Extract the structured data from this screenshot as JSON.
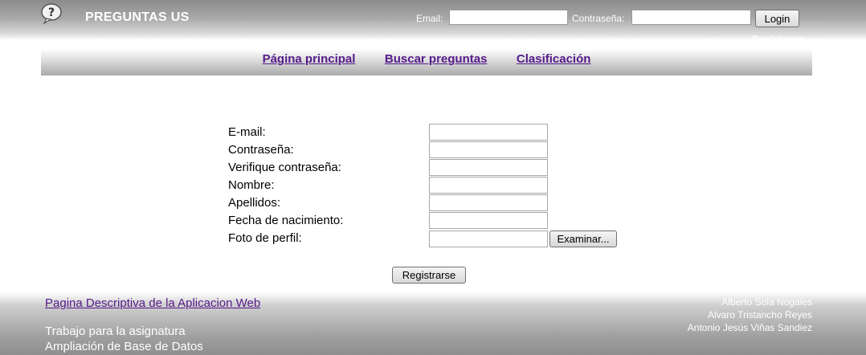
{
  "header": {
    "title": "PREGUNTAS US",
    "logo_icon": "speech-bubble-question-icon",
    "login": {
      "email_label": "Email:",
      "email_value": "",
      "password_label": "Contraseña:",
      "password_value": "",
      "login_button": "Login",
      "register_link": "Registrarse"
    }
  },
  "nav": {
    "items": [
      {
        "label": "Página principal"
      },
      {
        "label": "Buscar preguntas"
      },
      {
        "label": "Clasificación"
      }
    ]
  },
  "form": {
    "fields": [
      {
        "label": "E-mail:",
        "value": ""
      },
      {
        "label": "Contraseña:",
        "value": ""
      },
      {
        "label": "Verifique contraseña:",
        "value": ""
      },
      {
        "label": "Nombre:",
        "value": ""
      },
      {
        "label": "Apellidos:",
        "value": ""
      },
      {
        "label": "Fecha de nacimiento:",
        "value": ""
      },
      {
        "label": "Foto de perfil:",
        "value": ""
      }
    ],
    "browse_button": "Examinar...",
    "submit_button": "Registrarse"
  },
  "footer": {
    "link": "Pagina Descriptiva de la Aplicacion Web",
    "text_line1": "Trabajo para la asignatura",
    "text_line2": "Ampliación de Base de Datos",
    "authors": [
      "Alberto Sola Nogales",
      "Alvaro Tristancho Reyes",
      "Antonio Jesús Viñas Sandiez"
    ]
  },
  "colors": {
    "link_visited": "#551a8b",
    "header_gray": "#9a9a9a"
  }
}
